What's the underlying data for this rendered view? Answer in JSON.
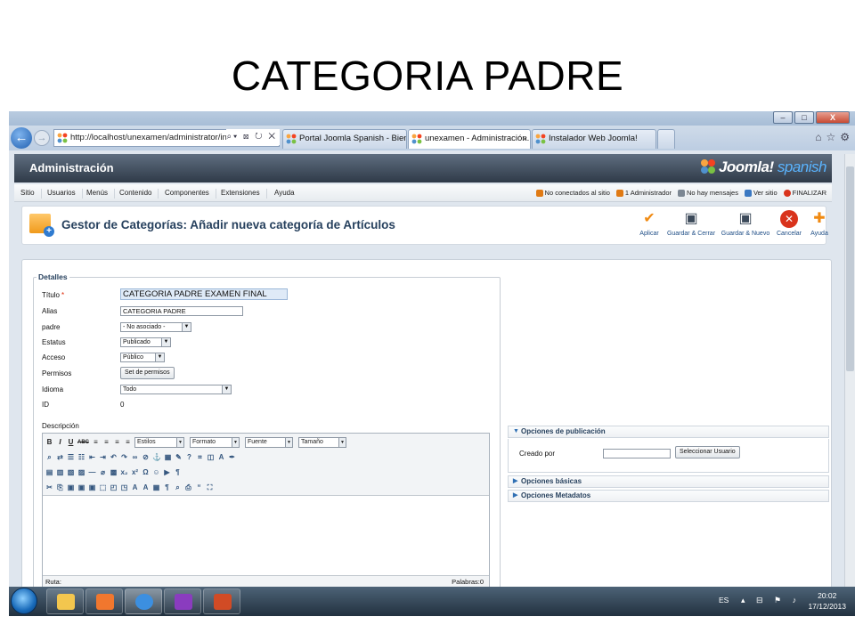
{
  "slide": {
    "title": "CATEGORIA PADRE"
  },
  "browser": {
    "window_controls": {
      "minimize": "–",
      "maximize": "□",
      "close": "X"
    },
    "address": "http://localhost/unexamen/administrator/index",
    "address_tools": "⌕▾ ⊠ ↻ ✕",
    "tabs": [
      {
        "label": "Portal Joomla Spanish - Bienve..."
      },
      {
        "label": "unexamen - Administración...",
        "close": "×"
      },
      {
        "label": "Instalador Web Joomla!"
      }
    ],
    "nav_icons": [
      "⌂",
      "☆",
      "⚙"
    ]
  },
  "joomla": {
    "header_title": "Administración",
    "logo_text": "Joomla!",
    "logo_sub": "spanish",
    "menu": [
      "Sitio",
      "Usuarios",
      "Menús",
      "Contenido",
      "Componentes",
      "Extensiones",
      "Ayuda"
    ],
    "status": [
      {
        "label": "No conectados al sitio",
        "color": "#e07a14"
      },
      {
        "label": "1 Administrador",
        "color": "#e07a14"
      },
      {
        "label": "No hay mensajes",
        "color": "#7c8793"
      },
      {
        "label": "Ver sitio",
        "color": "#3a78c2"
      },
      {
        "label": "FINALIZAR",
        "color": "#d9331c"
      }
    ],
    "page_title": "Gestor de Categorías: Añadir nueva categoría de Artículos",
    "toolbar": {
      "apply": "Aplicar",
      "save_close": "Guardar & Cerrar",
      "save_new": "Guardar & Nuevo",
      "cancel": "Cancelar",
      "help": "Ayuda"
    },
    "details": {
      "legend": "Detalles",
      "title_label": "Título",
      "title_value": "CATEGORIA PADRE EXAMEN FINAL",
      "alias_label": "Alias",
      "alias_value": "CATEGORIA PADRE",
      "parent_label": "padre",
      "parent_value": "- No asociado -",
      "status_label": "Estatus",
      "status_value": "Publicado",
      "access_label": "Acceso",
      "access_value": "Público",
      "permissions_label": "Permisos",
      "permissions_button": "Set de permisos",
      "language_label": "Idioma",
      "language_value": "Todo",
      "id_label": "ID",
      "id_value": "0",
      "description_label": "Descripción"
    },
    "editor": {
      "selects": [
        "Estilos",
        "Formato",
        "Fuente",
        "Tamaño"
      ],
      "path_label": "Ruta:",
      "words_label": "Palabras:0"
    },
    "publishing": {
      "header": "Opciones de publicación",
      "created_by_label": "Creado por",
      "select_user_button": "Seleccionar Usuario",
      "basic_options": "Opciones básicas",
      "metadata_options": "Opciones Metadatos"
    }
  },
  "taskbar": {
    "lang": "ES",
    "time": "20:02",
    "date": "17/12/2013"
  }
}
